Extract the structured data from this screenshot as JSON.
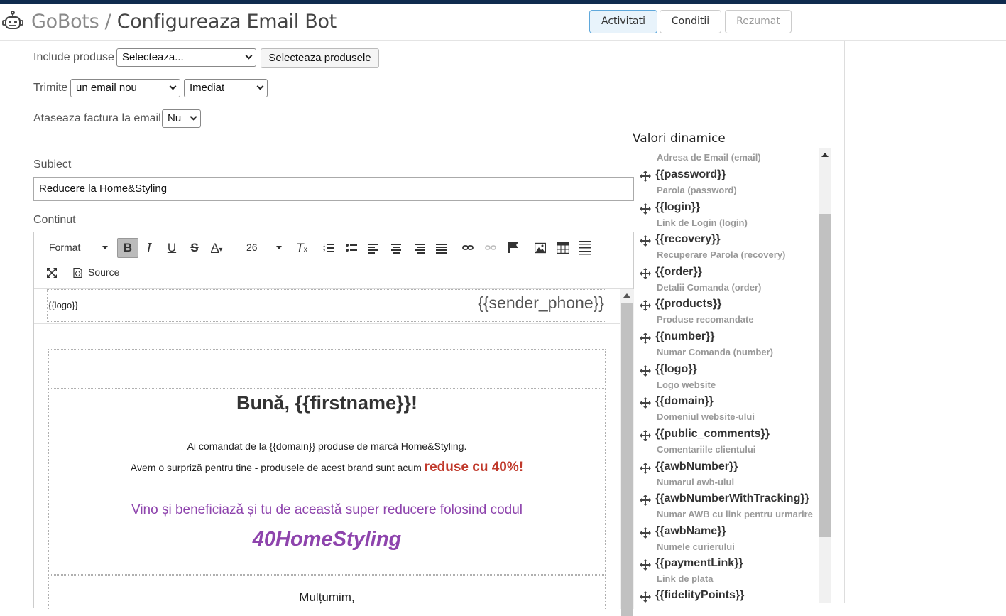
{
  "header": {
    "brand": "GoBots",
    "separator": "/",
    "title": "Configureaza Email Bot",
    "tabs": [
      {
        "label": "Activitati",
        "state": "active"
      },
      {
        "label": "Conditii",
        "state": "normal"
      },
      {
        "label": "Rezumat",
        "state": "disabled"
      }
    ]
  },
  "form": {
    "include_label": "Include produse",
    "include_select": "Selecteaza...",
    "select_products_button": "Selecteaza produsele",
    "send_label": "Trimite",
    "send_select": "un email nou",
    "timing_select": "Imediat",
    "invoice_label": "Ataseaza factura la email",
    "invoice_select": "Nu",
    "subject_label": "Subiect",
    "subject_value": "Reducere la Home&Styling",
    "content_label": "Continut"
  },
  "toolbar": {
    "format": "Format",
    "font_size": "26",
    "source": "Source"
  },
  "email": {
    "logo": "{{logo}}",
    "sender_phone": "{{sender_phone}}",
    "greeting": "Bună, {{firstname}}!",
    "line1": "Ai comandat de la {{domain}} produse de marcă Home&Styling.",
    "line2": "Avem o surpriză pentru tine - produsele de acest brand sunt acum",
    "highlight": "reduse cu 40%!",
    "cta": "Vino și beneficiază și tu de această super reducere folosind codul",
    "code": "40HomeStyling",
    "thanks": "Mulțumim,"
  },
  "colors": {
    "highlight": "#c0392b",
    "purple": "#8e44ad",
    "topbar": "#0f2b4e",
    "active_tab": "#e8f3fb"
  },
  "panel": {
    "title": "Valori dinamice",
    "partial_desc": "Adresa de Email (email)",
    "vars": [
      {
        "tag": "{{password}}",
        "desc": "Parola (password)"
      },
      {
        "tag": "{{login}}",
        "desc": "Link de Login (login)"
      },
      {
        "tag": "{{recovery}}",
        "desc": "Recuperare Parola (recovery)"
      },
      {
        "tag": "{{order}}",
        "desc": "Detalii Comanda (order)"
      },
      {
        "tag": "{{products}}",
        "desc": "Produse recomandate"
      },
      {
        "tag": "{{number}}",
        "desc": "Numar Comanda (number)"
      },
      {
        "tag": "{{logo}}",
        "desc": "Logo website"
      },
      {
        "tag": "{{domain}}",
        "desc": "Domeniul website-ului"
      },
      {
        "tag": "{{public_comments}}",
        "desc": "Comentariile clientului"
      },
      {
        "tag": "{{awbNumber}}",
        "desc": "Numarul awb-ului"
      },
      {
        "tag": "{{awbNumberWithTracking}}",
        "desc": "Numar AWB cu link pentru urmarire"
      },
      {
        "tag": "{{awbName}}",
        "desc": "Numele curierului"
      },
      {
        "tag": "{{paymentLink}}",
        "desc": "Link de plata"
      },
      {
        "tag": "{{fidelityPoints}}",
        "desc": ""
      }
    ]
  }
}
